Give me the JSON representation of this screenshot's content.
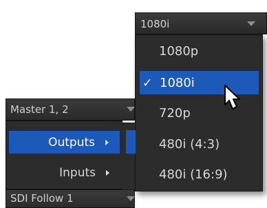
{
  "resolution_select": {
    "value": "1080i",
    "options": [
      {
        "label": "1080p",
        "selected": false
      },
      {
        "label": "1080i",
        "selected": true
      },
      {
        "label": "720p",
        "selected": false
      },
      {
        "label": "480i (4:3)",
        "selected": false
      },
      {
        "label": "480i (16:9)",
        "selected": false
      }
    ],
    "check_mark": "✓"
  },
  "master_select": {
    "value": "Master 1, 2",
    "menu": [
      {
        "label": "Outputs",
        "selected": true,
        "has_submenu": true
      },
      {
        "label": "Inputs",
        "selected": false,
        "has_submenu": true
      }
    ]
  },
  "sdi_select": {
    "value": "SDI Follow 1"
  },
  "colors": {
    "highlight": "#1c59b8",
    "menu_bg": "#2c2c2c",
    "text": "#d8d8d8"
  }
}
